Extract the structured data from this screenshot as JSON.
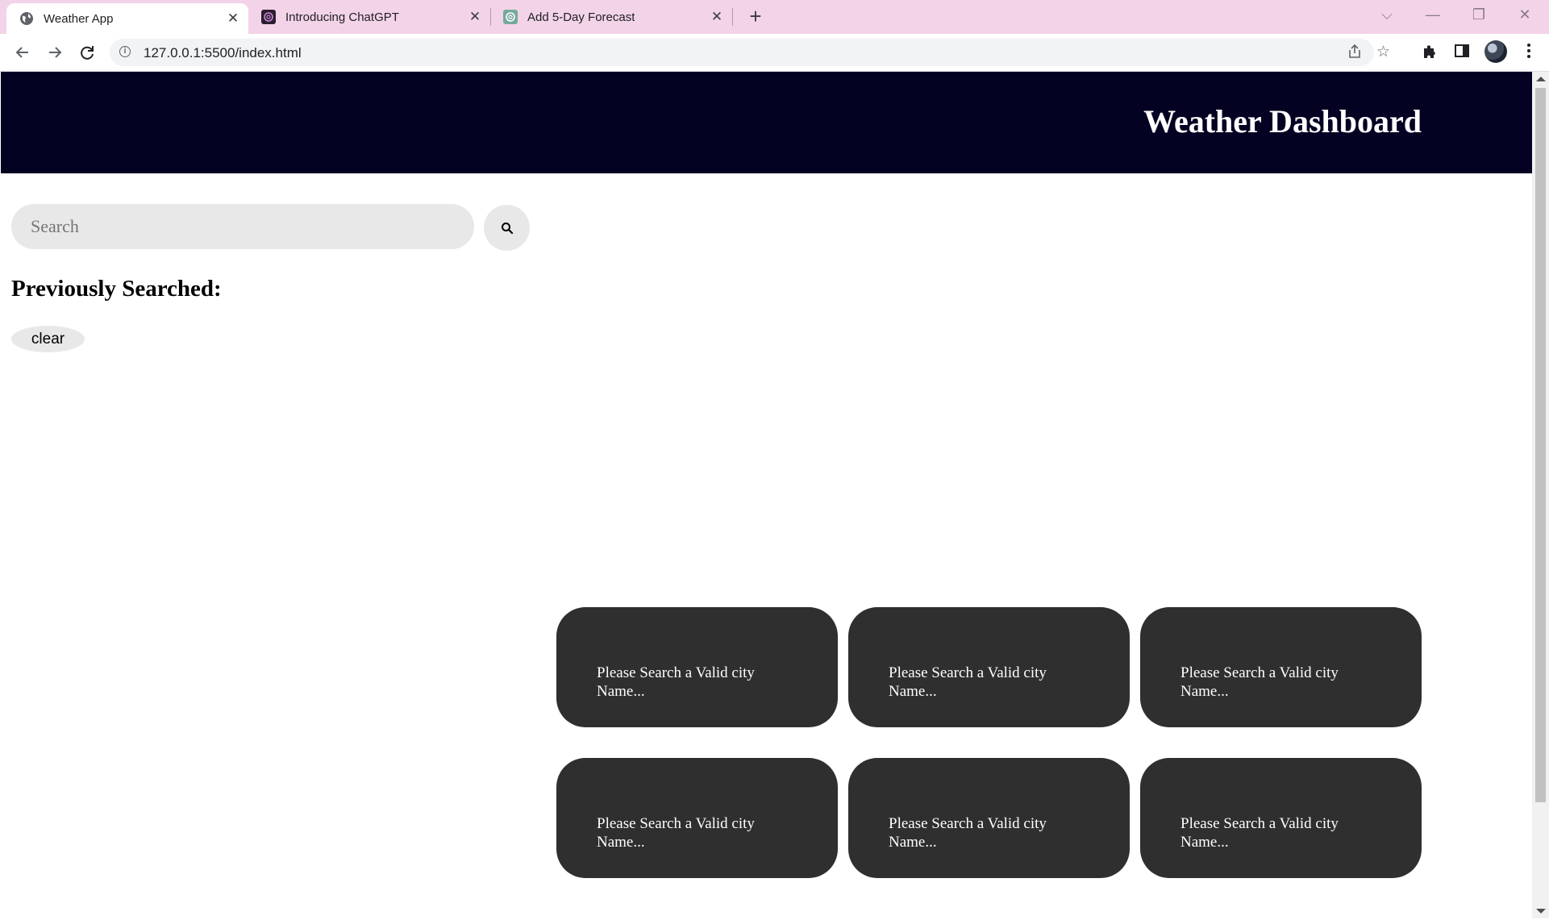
{
  "browser": {
    "tabs": [
      {
        "title": "Weather App",
        "active": true,
        "icon": "globe-icon"
      },
      {
        "title": "Introducing ChatGPT",
        "active": false,
        "icon": "openai-icon"
      },
      {
        "title": "Add 5-Day Forecast",
        "active": false,
        "icon": "chatgpt-icon"
      }
    ],
    "url": "127.0.0.1:5500/index.html",
    "tab_color": "#f3d3e8"
  },
  "header": {
    "title": "Weather Dashboard",
    "background": "#040223"
  },
  "search": {
    "placeholder": "Search",
    "value": "",
    "button_icon": "search-icon"
  },
  "history": {
    "heading": "Previously Searched:",
    "clear_label": "clear",
    "items": []
  },
  "forecast": {
    "card_color": "#2f2f2f",
    "cards": [
      {
        "message": "Please Search a Valid city Name..."
      },
      {
        "message": "Please Search a Valid city Name..."
      },
      {
        "message": "Please Search a Valid city Name..."
      },
      {
        "message": "Please Search a Valid city Name..."
      },
      {
        "message": "Please Search a Valid city Name..."
      },
      {
        "message": "Please Search a Valid city Name..."
      }
    ]
  }
}
